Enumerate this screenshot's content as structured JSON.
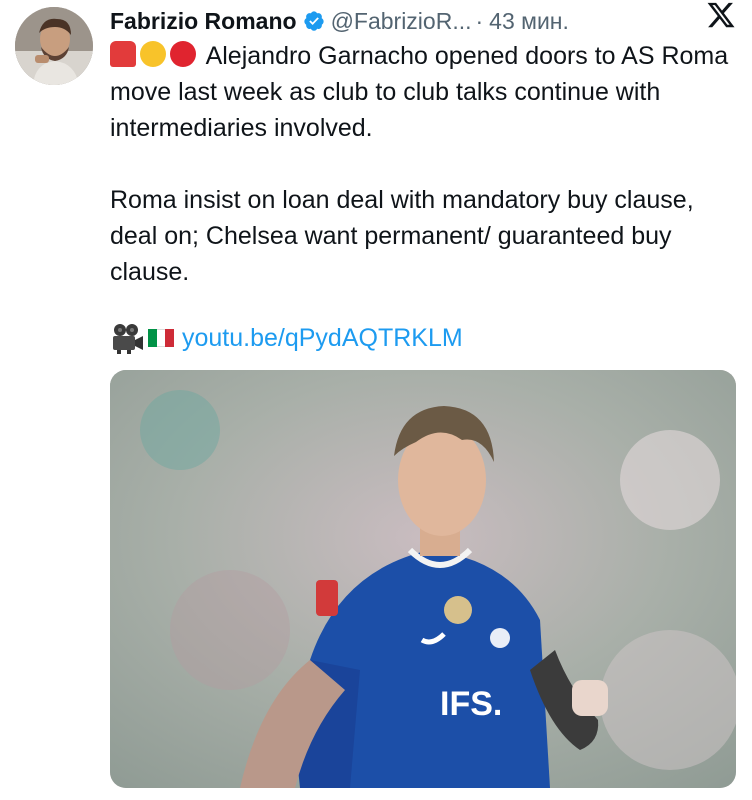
{
  "author": {
    "display_name": "Fabrizio Romano",
    "handle": "@FabrizioR...",
    "separator": "·",
    "time": "43 мин."
  },
  "icons": {
    "verified": "verified-badge-icon",
    "platform": "x-logo-icon",
    "emojis": [
      "siren-icon",
      "yellow-circle-icon",
      "red-circle-icon"
    ],
    "link_prefix": [
      "movie-camera-icon",
      "italy-flag-icon"
    ]
  },
  "colors": {
    "text": "#0f1419",
    "muted": "#536471",
    "link": "#1d9bf0",
    "verified": "#1d9bf0"
  },
  "tweet": {
    "line1": "Alejandro Garnacho opened doors to AS Roma move last week as club to club talks continue with intermediaries involved.",
    "line2": "Roma insist on loan deal with mandatory buy clause, deal on; Chelsea want permanent/ guaranteed buy clause.",
    "link": "youtu.be/qPydAQTRKLM"
  },
  "media": {
    "shirt_sponsor": "IFS."
  }
}
